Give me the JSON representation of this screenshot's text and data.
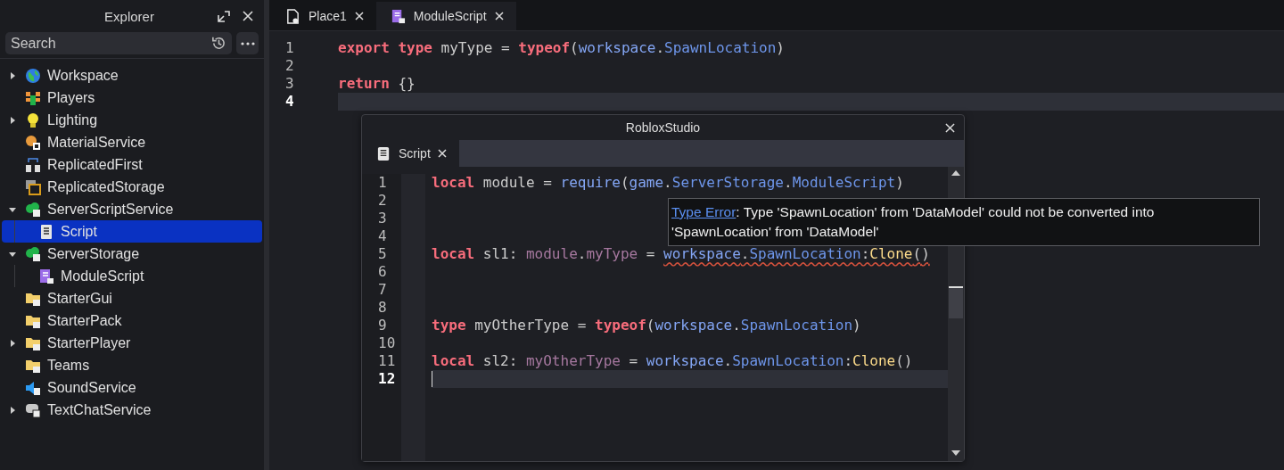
{
  "explorer": {
    "title": "Explorer",
    "search": {
      "placeholder": "Search"
    },
    "items": [
      {
        "name": "Workspace",
        "kind": "globe",
        "expanded": false,
        "selected": false
      },
      {
        "name": "Players",
        "kind": "players",
        "selected": false
      },
      {
        "name": "Lighting",
        "kind": "bulb",
        "expanded": false,
        "selected": false
      },
      {
        "name": "MaterialService",
        "kind": "material",
        "selected": false
      },
      {
        "name": "ReplicatedFirst",
        "kind": "replicated",
        "selected": false
      },
      {
        "name": "ReplicatedStorage",
        "kind": "storage",
        "selected": false
      },
      {
        "name": "ServerScriptService",
        "kind": "servercloud",
        "expanded": true,
        "selected": false,
        "children": [
          {
            "name": "Script",
            "kind": "script",
            "selected": true
          }
        ]
      },
      {
        "name": "ServerStorage",
        "kind": "serverstorage",
        "expanded": true,
        "selected": false,
        "children": [
          {
            "name": "ModuleScript",
            "kind": "module",
            "selected": false
          }
        ]
      },
      {
        "name": "StarterGui",
        "kind": "folder",
        "selected": false
      },
      {
        "name": "StarterPack",
        "kind": "folder",
        "selected": false
      },
      {
        "name": "StarterPlayer",
        "kind": "folder",
        "expanded": false,
        "selected": false
      },
      {
        "name": "Teams",
        "kind": "folder",
        "selected": false
      },
      {
        "name": "SoundService",
        "kind": "sound",
        "selected": false
      },
      {
        "name": "TextChatService",
        "kind": "chat",
        "expanded": false,
        "selected": false
      }
    ]
  },
  "tabs": [
    {
      "label": "Place1",
      "kind": "place",
      "selected": false
    },
    {
      "label": "ModuleScript",
      "kind": "module",
      "selected": true
    }
  ],
  "editor": {
    "focused": false,
    "lines": [
      {
        "num": "1",
        "current": false,
        "tokens": [
          {
            "t": "export type",
            "kind": "kw"
          },
          {
            "t": " myType = ",
            "kind": "plain"
          },
          {
            "t": "typeof",
            "kind": "kw"
          },
          {
            "t": "(",
            "kind": "plain"
          },
          {
            "t": "workspace",
            "kind": "global"
          },
          {
            "t": ".",
            "kind": "plain"
          },
          {
            "t": "SpawnLocation",
            "kind": "prop"
          },
          {
            "t": ")",
            "kind": "plain"
          }
        ]
      },
      {
        "num": "2",
        "current": false
      },
      {
        "num": "3",
        "current": false,
        "tokens": [
          {
            "t": "return",
            "kind": "kw"
          },
          {
            "t": " {}",
            "kind": "plain"
          }
        ]
      },
      {
        "num": "4",
        "current": true
      }
    ]
  },
  "popup": {
    "title": "RobloxStudio",
    "tab": {
      "label": "Script",
      "kind": "script",
      "selected": true
    },
    "editor": {
      "focused": true,
      "lines": [
        {
          "num": "1",
          "current": false,
          "tokens": [
            {
              "t": "local",
              "kind": "kw"
            },
            {
              "t": " module = ",
              "kind": "plain"
            },
            {
              "t": "require",
              "kind": "global"
            },
            {
              "t": "(",
              "kind": "plain"
            },
            {
              "t": "game",
              "kind": "global"
            },
            {
              "t": ".",
              "kind": "plain"
            },
            {
              "t": "ServerStorage",
              "kind": "prop"
            },
            {
              "t": ".",
              "kind": "plain"
            },
            {
              "t": "ModuleScript",
              "kind": "prop"
            },
            {
              "t": ")",
              "kind": "plain"
            }
          ]
        },
        {
          "num": "2",
          "current": false
        },
        {
          "num": "3",
          "current": false
        },
        {
          "num": "4",
          "current": false
        },
        {
          "num": "5",
          "current": false,
          "tokens": [
            {
              "t": "local",
              "kind": "kw"
            },
            {
              "t": " sl1: ",
              "kind": "plain"
            },
            {
              "t": "module",
              "kind": "typeref"
            },
            {
              "t": ".",
              "kind": "plain"
            },
            {
              "t": "myType",
              "kind": "typeref"
            },
            {
              "t": " = ",
              "kind": "plain"
            },
            {
              "t": "workspace.SpawnLocation:Clone()",
              "kind": "error"
            }
          ]
        },
        {
          "num": "6",
          "current": false
        },
        {
          "num": "7",
          "current": false
        },
        {
          "num": "8",
          "current": false
        },
        {
          "num": "9",
          "current": false,
          "tokens": [
            {
              "t": "type",
              "kind": "kw"
            },
            {
              "t": " myOtherType = ",
              "kind": "plain"
            },
            {
              "t": "typeof",
              "kind": "kw"
            },
            {
              "t": "(",
              "kind": "plain"
            },
            {
              "t": "workspace",
              "kind": "global"
            },
            {
              "t": ".",
              "kind": "plain"
            },
            {
              "t": "SpawnLocation",
              "kind": "prop"
            },
            {
              "t": ")",
              "kind": "plain"
            }
          ]
        },
        {
          "num": "10",
          "current": false
        },
        {
          "num": "11",
          "current": false,
          "tokens": [
            {
              "t": "local",
              "kind": "kw"
            },
            {
              "t": " sl2: ",
              "kind": "plain"
            },
            {
              "t": "myOtherType",
              "kind": "typeref"
            },
            {
              "t": " = ",
              "kind": "plain"
            },
            {
              "t": "workspace",
              "kind": "global"
            },
            {
              "t": ".",
              "kind": "plain"
            },
            {
              "t": "SpawnLocation",
              "kind": "prop"
            },
            {
              "t": ":",
              "kind": "plain"
            },
            {
              "t": "Clone",
              "kind": "method"
            },
            {
              "t": "()",
              "kind": "plain"
            }
          ]
        },
        {
          "num": "12",
          "current": true
        }
      ]
    }
  },
  "tooltip": {
    "link": "Type Error",
    "text": ": Type 'SpawnLocation' from 'DataModel' could not be converted into 'SpawnLocation' from 'DataModel'"
  }
}
